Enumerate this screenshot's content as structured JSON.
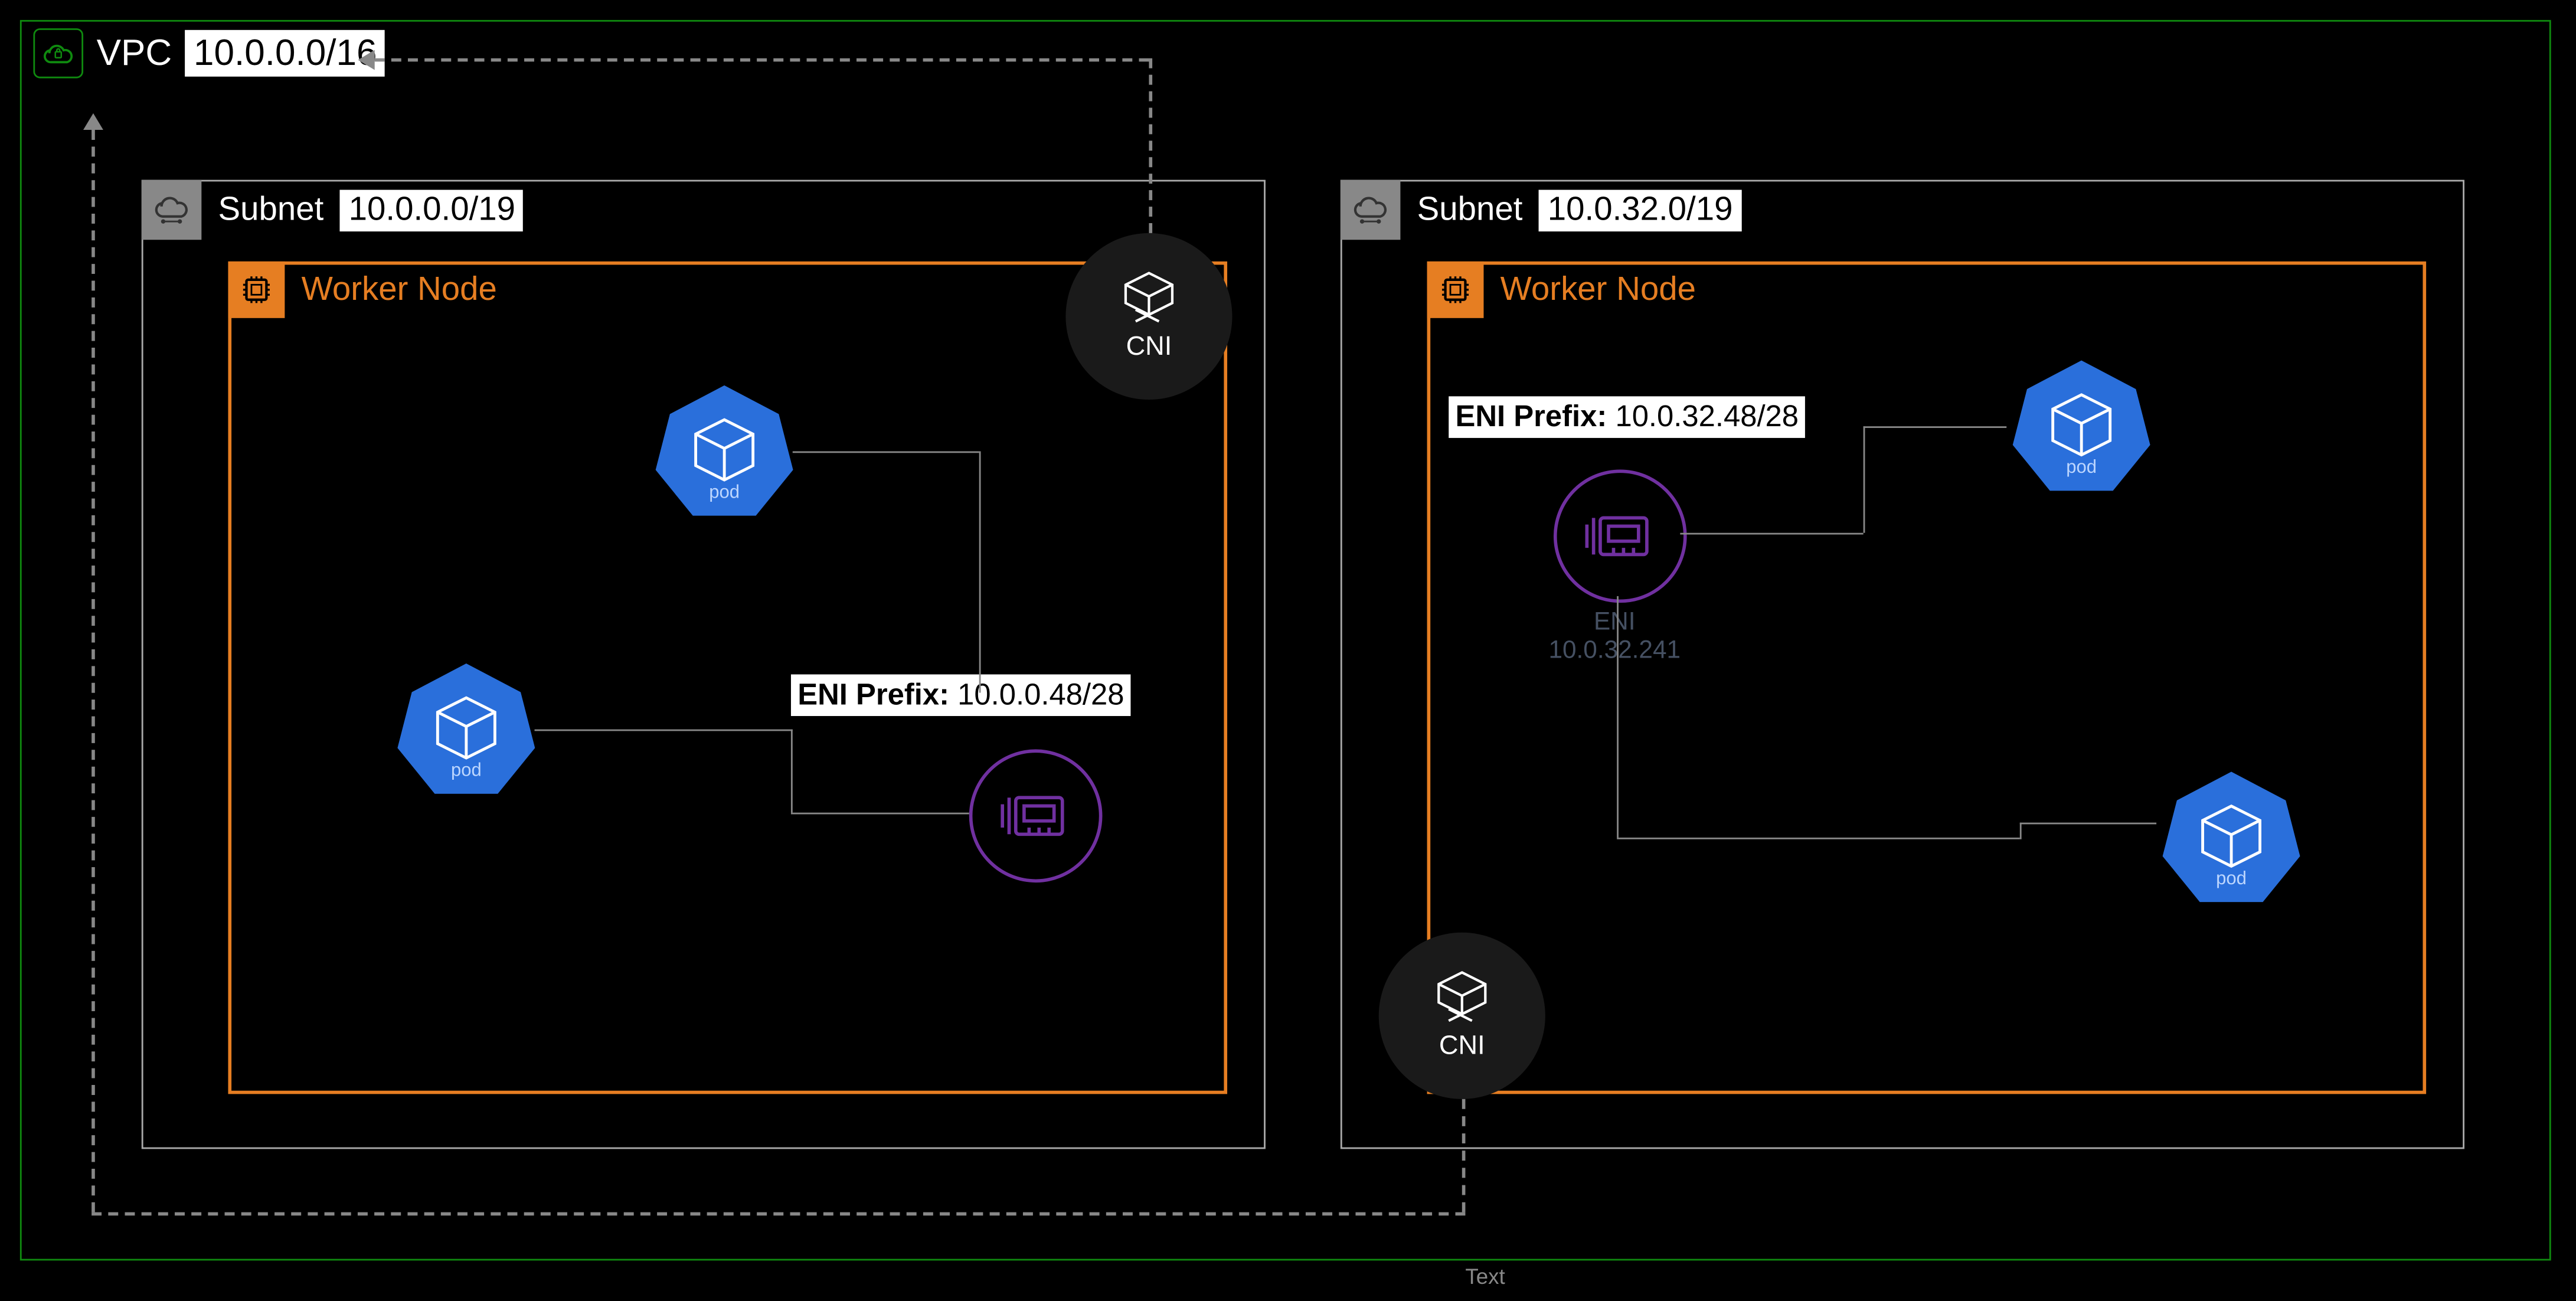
{
  "vpc": {
    "label": "VPC",
    "cidr": "10.0.0.0/16"
  },
  "subnets": {
    "left": {
      "label": "Subnet",
      "cidr": "10.0.0.0/19"
    },
    "right": {
      "label": "Subnet",
      "cidr": "10.0.32.0/19"
    }
  },
  "worker_label": "Worker Node",
  "pod_label": "pod",
  "cni_label": "CNI",
  "eni_prefixes": {
    "left": {
      "label": "ENI Prefix:",
      "value": "10.0.0.48/28"
    },
    "right": {
      "label": "ENI Prefix:",
      "value": "10.0.32.48/28"
    }
  },
  "eni_dim": {
    "name": "ENI",
    "ip": "10.0.32.241"
  },
  "footer": "Text"
}
